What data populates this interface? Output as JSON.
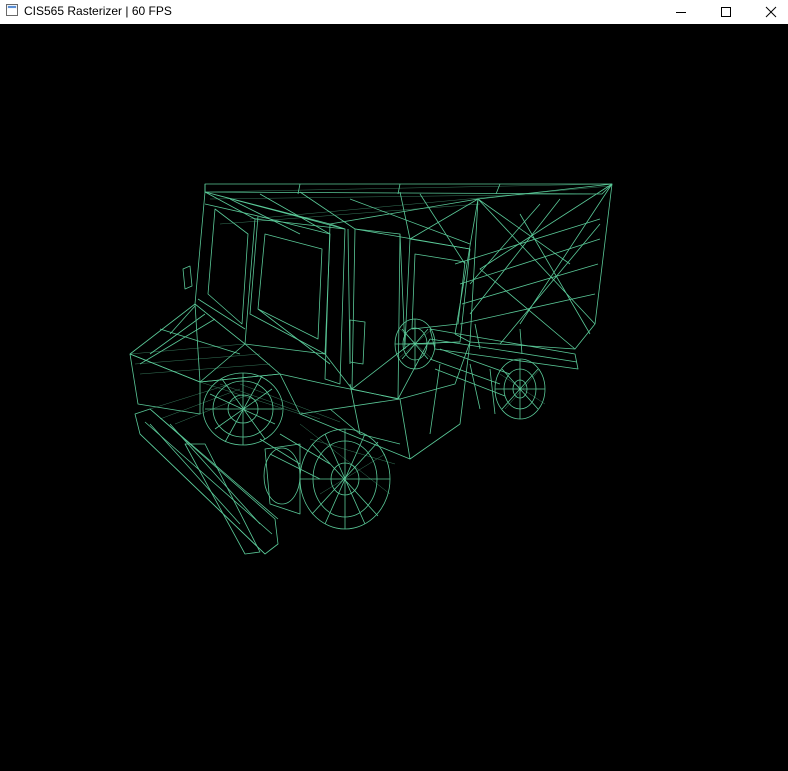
{
  "window": {
    "title": "CIS565 Rasterizer | 60 FPS",
    "background_color": "#000000",
    "controls": {
      "minimize": "minimize-icon",
      "maximize": "maximize-icon",
      "close": "close-icon"
    }
  },
  "viewport": {
    "render_mode": "wireframe",
    "model": "truck",
    "wire_color": "#5fd3a0"
  }
}
